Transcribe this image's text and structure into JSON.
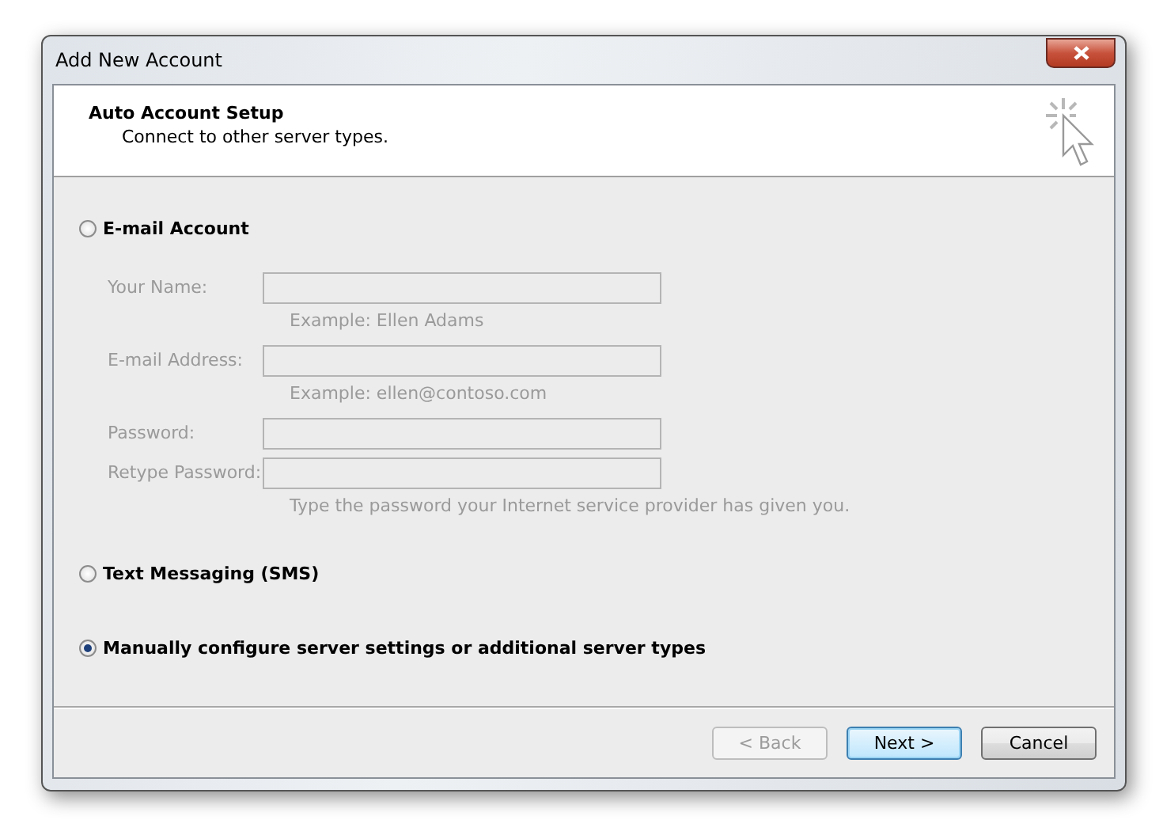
{
  "window": {
    "title": "Add New Account"
  },
  "header": {
    "title": "Auto Account Setup",
    "subtitle": "Connect to other server types."
  },
  "options": [
    {
      "label": "E-mail Account",
      "selected": false
    },
    {
      "label": "Text Messaging (SMS)",
      "selected": false
    },
    {
      "label": "Manually configure server settings or additional server types",
      "selected": true
    }
  ],
  "email_form": {
    "disabled": true,
    "fields": [
      {
        "label": "Your Name:",
        "hint": "Example: Ellen Adams"
      },
      {
        "label": "E-mail Address:",
        "hint": "Example: ellen@contoso.com"
      },
      {
        "label": "Password:"
      },
      {
        "label": "Retype Password:",
        "hint": "Type the password your Internet service provider has given you."
      }
    ]
  },
  "buttons": [
    {
      "label": "< Back",
      "disabled": true,
      "default": false
    },
    {
      "label": "Next >",
      "disabled": false,
      "default": true
    },
    {
      "label": "Cancel",
      "disabled": false,
      "default": false
    }
  ]
}
